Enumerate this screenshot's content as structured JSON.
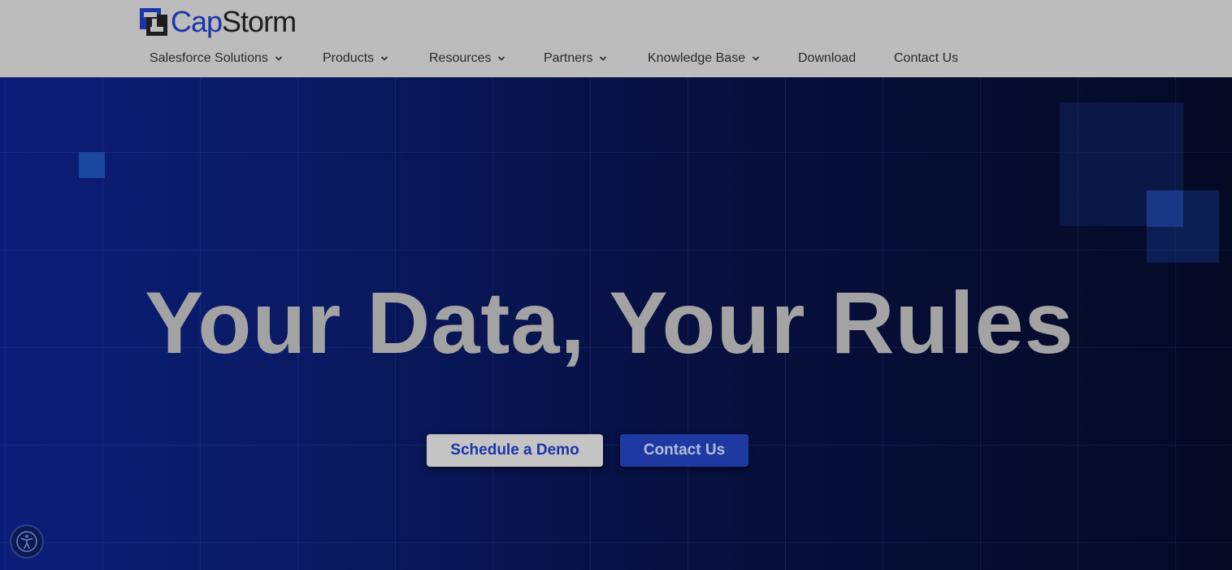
{
  "logo": {
    "cap": "Cap",
    "storm": "Storm"
  },
  "nav": {
    "items": [
      {
        "label": "Salesforce Solutions",
        "dropdown": true
      },
      {
        "label": "Products",
        "dropdown": true
      },
      {
        "label": "Resources",
        "dropdown": true
      },
      {
        "label": "Partners",
        "dropdown": true
      },
      {
        "label": "Knowledge Base",
        "dropdown": true
      },
      {
        "label": "Download",
        "dropdown": false
      },
      {
        "label": "Contact Us",
        "dropdown": false
      }
    ]
  },
  "hero": {
    "headline": "Your Data, Your Rules",
    "primary_button": "Schedule a Demo",
    "secondary_button": "Contact Us"
  },
  "accessibility": {
    "icon": "accessibility-icon"
  },
  "colors": {
    "brand_blue": "#1b35a8",
    "header_bg": "#bcbcbc",
    "hero_bg_left": "#0b1d78",
    "hero_bg_right": "#040a24"
  }
}
